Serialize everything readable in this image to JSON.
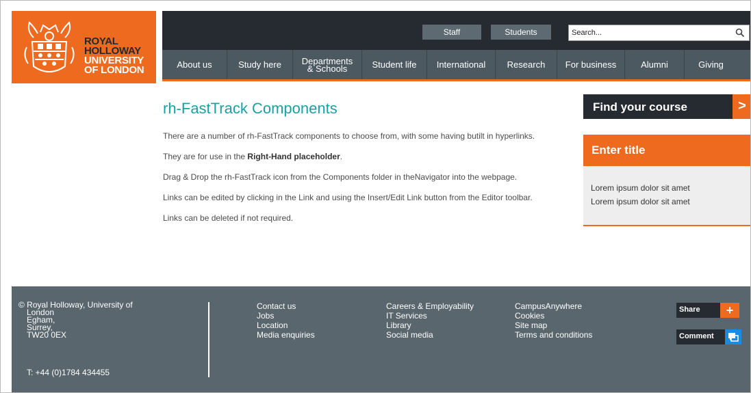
{
  "logo": {
    "line1": "ROYAL",
    "line2": "HOLLOWAY",
    "line3": "UNIVERSITY",
    "line4": "OF LONDON"
  },
  "header": {
    "staff_label": "Staff",
    "students_label": "Students",
    "search_placeholder": "Search..."
  },
  "nav": {
    "items": [
      {
        "label": "About us"
      },
      {
        "label": "Study here"
      },
      {
        "label": "Departments & Schools"
      },
      {
        "label": "Student life"
      },
      {
        "label": "International"
      },
      {
        "label": "Research"
      },
      {
        "label": "For business"
      },
      {
        "label": "Alumni"
      },
      {
        "label": "Giving"
      }
    ]
  },
  "main": {
    "title": "rh-FastTrack Components",
    "p1": "There are a number of rh-FastTrack components to choose from, with some having butilt in hyperlinks.",
    "p2_pre": "They are for use in the ",
    "p2_bold": "Right-Hand placeholder",
    "p2_post": ".",
    "p3": "Drag & Drop the rh-FastTrack icon from the Components folder in theNavigator into the webpage.",
    "p4": "Links can be edited by clicking in the Link and using the Insert/Edit Link button from the Editor toolbar.",
    "p5": "Links can be deleted if not required."
  },
  "sidebar": {
    "find_course_label": "Find your course",
    "find_course_arrow": ">",
    "panel_title": "Enter title",
    "links": [
      "Lorem ipsum dolor sit amet",
      "Lorem ipsum dolor sit amet"
    ]
  },
  "footer": {
    "address": {
      "line1": "© Royal Holloway, University of",
      "line2": "London",
      "line3": "Egham,",
      "line4": "Surrey,",
      "line5": "TW20 0EX"
    },
    "phone": "T: +44 (0)1784 434455",
    "col1": [
      "Contact us",
      "Jobs",
      "Location",
      "Media enquiries"
    ],
    "col2": [
      "Careers & Employability",
      "IT Services",
      "Library",
      "Social media"
    ],
    "col3": [
      "CampusAnywhere",
      "Cookies",
      "Site map",
      "Terms and conditions"
    ],
    "share_label": "Share",
    "share_icon": "+",
    "comment_label": "Comment"
  },
  "colors": {
    "brand_orange": "#ee6a1f",
    "dark": "#252b30",
    "nav": "#4d5961",
    "footer": "#5a666d",
    "title_teal": "#1aa0a3",
    "comment_blue": "#1b8be0"
  },
  "icons": {
    "search": "magnifier-icon",
    "share": "plus-icon",
    "comment": "speech-bubble-icon",
    "crest": "university-crest-icon"
  }
}
